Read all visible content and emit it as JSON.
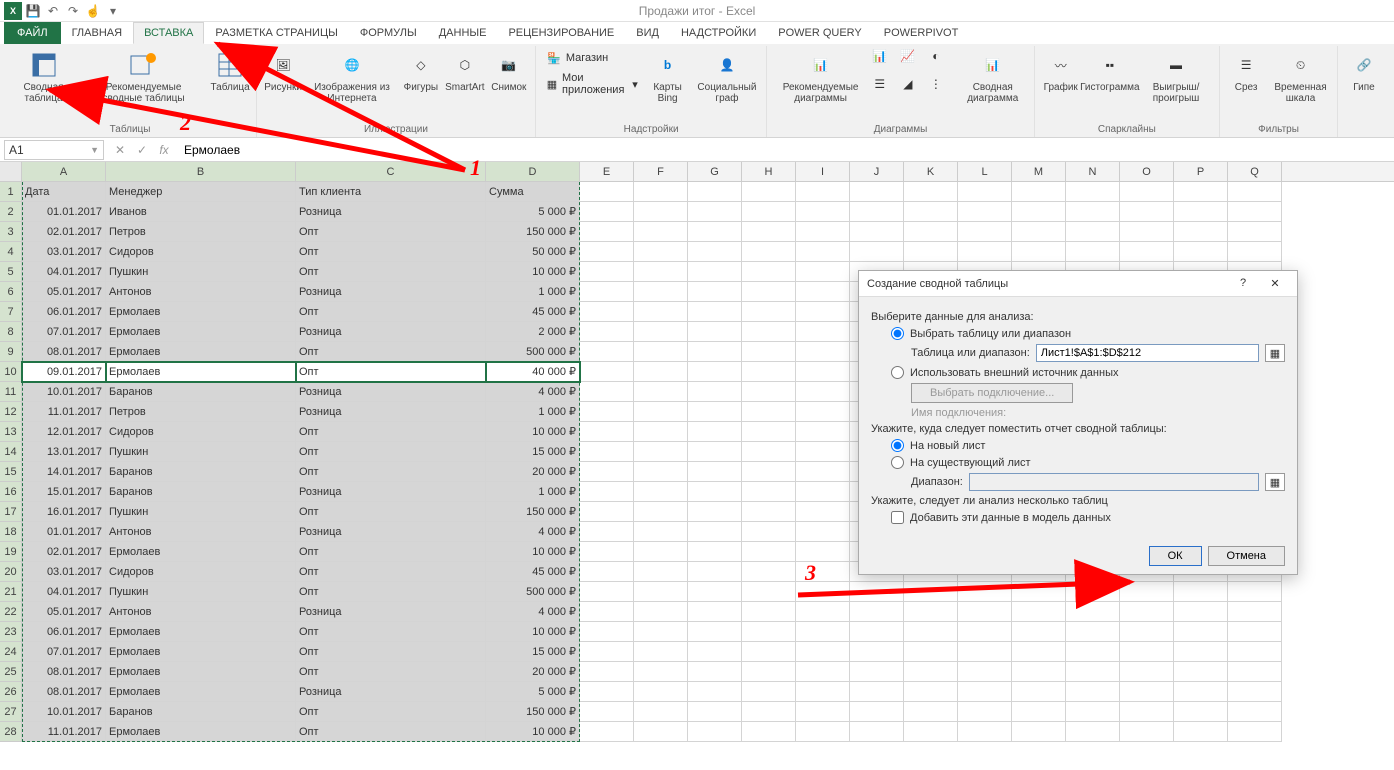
{
  "title": "Продажи итог - Excel",
  "tabs": {
    "file": "ФАЙЛ",
    "home": "ГЛАВНАЯ",
    "insert": "ВСТАВКА",
    "layout": "РАЗМЕТКА СТРАНИЦЫ",
    "formulas": "ФОРМУЛЫ",
    "data": "ДАННЫЕ",
    "review": "РЕЦЕНЗИРОВАНИЕ",
    "view": "ВИД",
    "addins": "НАДСТРОЙКИ",
    "powerquery": "POWER QUERY",
    "powerpivot": "POWERPIVOT"
  },
  "ribbon": {
    "pivot": "Сводная таблица",
    "recpivot": "Рекомендуемые сводные таблицы",
    "table": "Таблица",
    "group_tables": "Таблицы",
    "pictures": "Рисунки",
    "online_pics": "Изображения из Интернета",
    "shapes": "Фигуры",
    "smartart": "SmartArt",
    "screenshot": "Снимок",
    "group_illus": "Иллюстрации",
    "store": "Магазин",
    "myapps": "Мои приложения",
    "bing": "Карты Bing",
    "social": "Социальный граф",
    "group_addins": "Надстройки",
    "reccharts": "Рекомендуемые диаграммы",
    "pivotchart": "Сводная диаграмма",
    "group_charts": "Диаграммы",
    "line": "График",
    "column": "Гистограмма",
    "winloss": "Выигрыш/проигрыш",
    "group_spark": "Спарклайны",
    "slicer": "Срез",
    "timeline": "Временная шкала",
    "group_filters": "Фильтры",
    "hyper": "Гипе"
  },
  "fbar": {
    "name_box": "A1",
    "formula": "Ермолаев",
    "fx": "fx"
  },
  "cols": [
    "A",
    "B",
    "C",
    "D",
    "E",
    "F",
    "G",
    "H",
    "I",
    "J",
    "K",
    "L",
    "M",
    "N",
    "O",
    "P",
    "Q"
  ],
  "headers": {
    "A": "Дата",
    "B": "Менеджер",
    "C": "Тип клиента",
    "D": "Сумма"
  },
  "rows": [
    {
      "n": 1
    },
    {
      "n": 2,
      "A": "01.01.2017",
      "B": "Иванов",
      "C": "Розница",
      "D": "5 000 ₽"
    },
    {
      "n": 3,
      "A": "02.01.2017",
      "B": "Петров",
      "C": "Опт",
      "D": "150 000 ₽"
    },
    {
      "n": 4,
      "A": "03.01.2017",
      "B": "Сидоров",
      "C": "Опт",
      "D": "50 000 ₽"
    },
    {
      "n": 5,
      "A": "04.01.2017",
      "B": "Пушкин",
      "C": "Опт",
      "D": "10 000 ₽"
    },
    {
      "n": 6,
      "A": "05.01.2017",
      "B": "Антонов",
      "C": "Розница",
      "D": "1 000 ₽"
    },
    {
      "n": 7,
      "A": "06.01.2017",
      "B": "Ермолаев",
      "C": "Опт",
      "D": "45 000 ₽"
    },
    {
      "n": 8,
      "A": "07.01.2017",
      "B": "Ермолаев",
      "C": "Розница",
      "D": "2 000 ₽"
    },
    {
      "n": 9,
      "A": "08.01.2017",
      "B": "Ермолаев",
      "C": "Опт",
      "D": "500 000 ₽"
    },
    {
      "n": 10,
      "A": "09.01.2017",
      "B": "Ермолаев",
      "C": "Опт",
      "D": "40 000 ₽",
      "active": true
    },
    {
      "n": 11,
      "A": "10.01.2017",
      "B": "Баранов",
      "C": "Розница",
      "D": "4 000 ₽"
    },
    {
      "n": 12,
      "A": "11.01.2017",
      "B": "Петров",
      "C": "Розница",
      "D": "1 000 ₽"
    },
    {
      "n": 13,
      "A": "12.01.2017",
      "B": "Сидоров",
      "C": "Опт",
      "D": "10 000 ₽"
    },
    {
      "n": 14,
      "A": "13.01.2017",
      "B": "Пушкин",
      "C": "Опт",
      "D": "15 000 ₽"
    },
    {
      "n": 15,
      "A": "14.01.2017",
      "B": "Баранов",
      "C": "Опт",
      "D": "20 000 ₽"
    },
    {
      "n": 16,
      "A": "15.01.2017",
      "B": "Баранов",
      "C": "Розница",
      "D": "1 000 ₽"
    },
    {
      "n": 17,
      "A": "16.01.2017",
      "B": "Пушкин",
      "C": "Опт",
      "D": "150 000 ₽"
    },
    {
      "n": 18,
      "A": "01.01.2017",
      "B": "Антонов",
      "C": "Розница",
      "D": "4 000 ₽"
    },
    {
      "n": 19,
      "A": "02.01.2017",
      "B": "Ермолаев",
      "C": "Опт",
      "D": "10 000 ₽"
    },
    {
      "n": 20,
      "A": "03.01.2017",
      "B": "Сидоров",
      "C": "Опт",
      "D": "45 000 ₽"
    },
    {
      "n": 21,
      "A": "04.01.2017",
      "B": "Пушкин",
      "C": "Опт",
      "D": "500 000 ₽"
    },
    {
      "n": 22,
      "A": "05.01.2017",
      "B": "Антонов",
      "C": "Розница",
      "D": "4 000 ₽"
    },
    {
      "n": 23,
      "A": "06.01.2017",
      "B": "Ермолаев",
      "C": "Опт",
      "D": "10 000 ₽"
    },
    {
      "n": 24,
      "A": "07.01.2017",
      "B": "Ермолаев",
      "C": "Опт",
      "D": "15 000 ₽"
    },
    {
      "n": 25,
      "A": "08.01.2017",
      "B": "Ермолаев",
      "C": "Опт",
      "D": "20 000 ₽"
    },
    {
      "n": 26,
      "A": "08.01.2017",
      "B": "Ермолаев",
      "C": "Розница",
      "D": "5 000 ₽"
    },
    {
      "n": 27,
      "A": "10.01.2017",
      "B": "Баранов",
      "C": "Опт",
      "D": "150 000 ₽"
    },
    {
      "n": 28,
      "A": "11.01.2017",
      "B": "Ермолаев",
      "C": "Опт",
      "D": "10 000 ₽"
    }
  ],
  "dialog": {
    "title": "Создание сводной таблицы",
    "help": "?",
    "section1": "Выберите данные для анализа:",
    "opt_select": "Выбрать таблицу или диапазон",
    "lbl_range": "Таблица или диапазон:",
    "range_val": "Лист1!$A$1:$D$212",
    "opt_external": "Использовать внешний источник данных",
    "btn_conn": "Выбрать подключение...",
    "lbl_conn": "Имя подключения:",
    "section2": "Укажите, куда следует поместить отчет сводной таблицы:",
    "opt_new": "На новый лист",
    "opt_exist": "На существующий лист",
    "lbl_range2": "Диапазон:",
    "section3": "Укажите, следует ли анализ несколько таблиц",
    "chk_model": "Добавить эти данные в модель данных",
    "ok": "ОК",
    "cancel": "Отмена"
  },
  "annotations": {
    "n1": "1",
    "n2": "2",
    "n3": "3"
  }
}
